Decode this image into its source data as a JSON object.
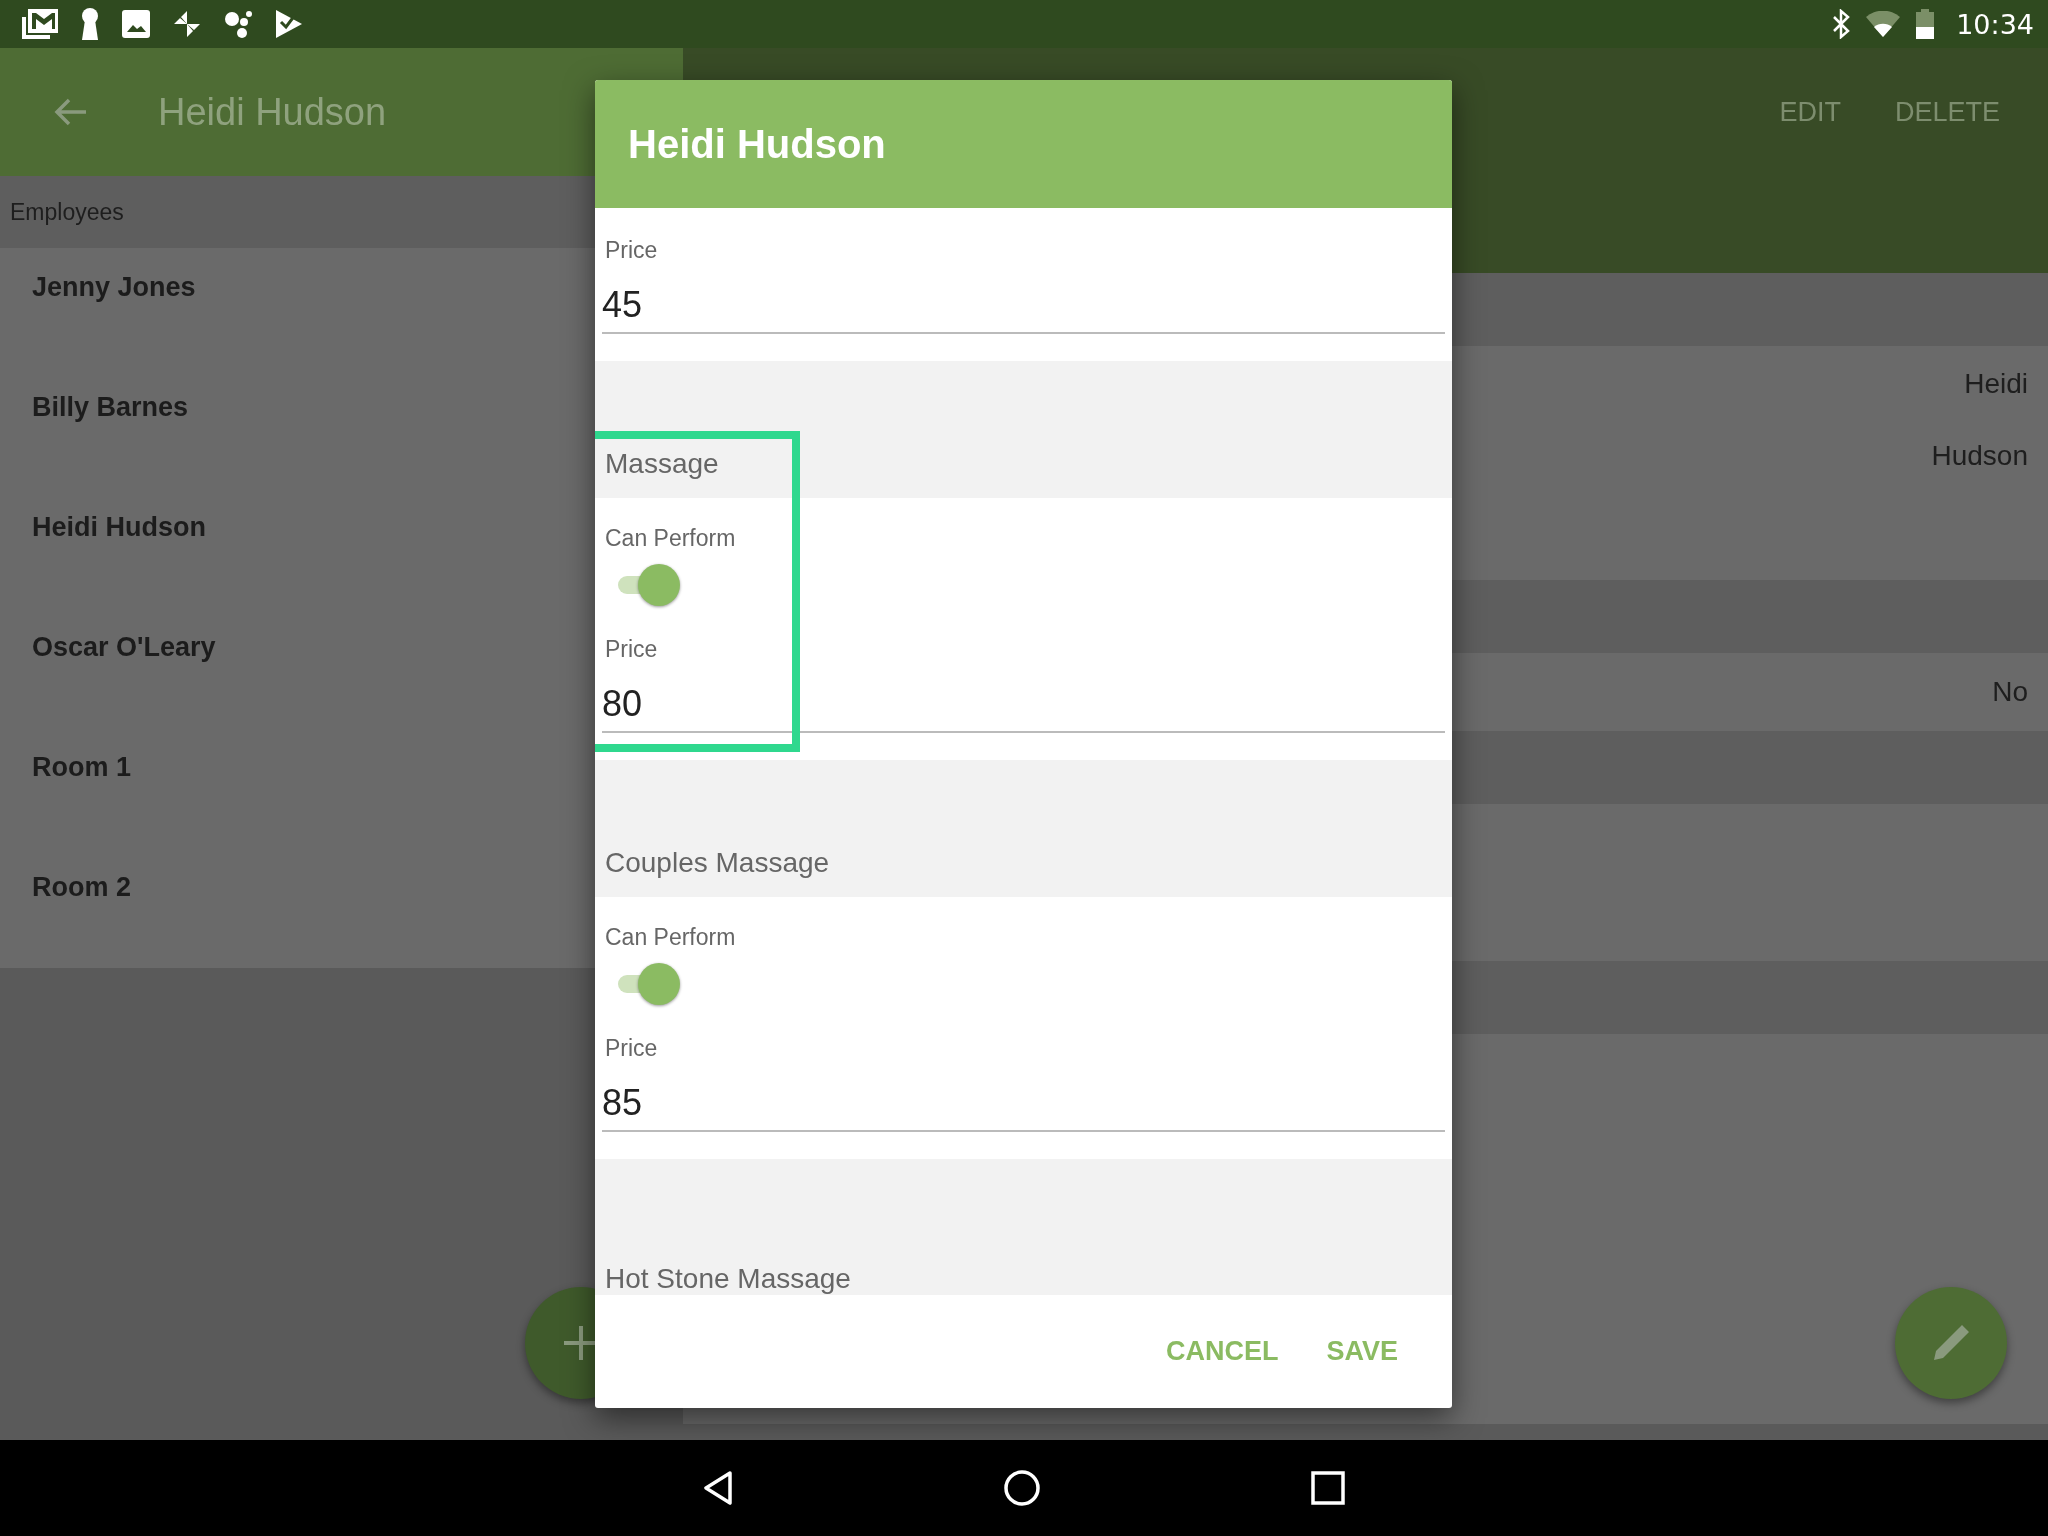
{
  "status_bar": {
    "time": "10:34"
  },
  "app_bar": {
    "title": "Heidi Hudson",
    "actions": [
      "EDIT",
      "DELETE"
    ]
  },
  "sidebar": {
    "header": "Employees",
    "items": [
      "Jenny Jones",
      "Billy Barnes",
      "Heidi Hudson",
      "Oscar O'Leary",
      "Room 1",
      "Room 2"
    ]
  },
  "detail": {
    "values": [
      "Heidi",
      "Hudson",
      "No"
    ]
  },
  "dialog": {
    "title": "Heidi Hudson",
    "sections": [
      {
        "kind": "price",
        "label": "Price",
        "value": "45"
      },
      {
        "kind": "service",
        "name": "Massage",
        "can_perform_label": "Can Perform",
        "on": true,
        "price_label": "Price",
        "price": "80",
        "highlighted": true
      },
      {
        "kind": "service",
        "name": "Couples Massage",
        "can_perform_label": "Can Perform",
        "on": true,
        "price_label": "Price",
        "price": "85"
      },
      {
        "kind": "heading",
        "name": "Hot Stone Massage"
      }
    ],
    "buttons": [
      "CANCEL",
      "SAVE"
    ]
  }
}
